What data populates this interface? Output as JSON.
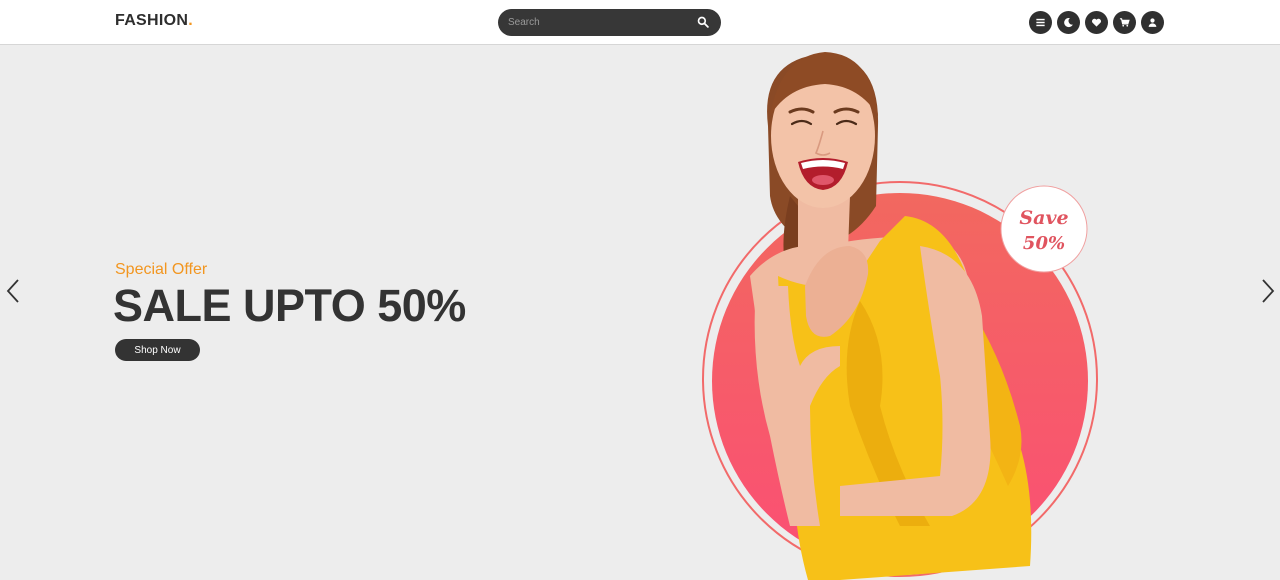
{
  "header": {
    "logo_text": "FASHION",
    "logo_dot": ".",
    "search_placeholder": "Search",
    "icons": [
      "menu-icon",
      "moon-icon",
      "heart-icon",
      "cart-icon",
      "user-icon"
    ]
  },
  "hero": {
    "kicker": "Special Offer",
    "title": "SALE UPTO 50%",
    "cta_label": "Shop Now",
    "badge_line1": "Save",
    "badge_line2": "50%"
  },
  "colors": {
    "accent": "#f29620",
    "dark": "#333333",
    "circle": "#f65a6e",
    "dress": "#f7c118",
    "background": "#ededed"
  }
}
